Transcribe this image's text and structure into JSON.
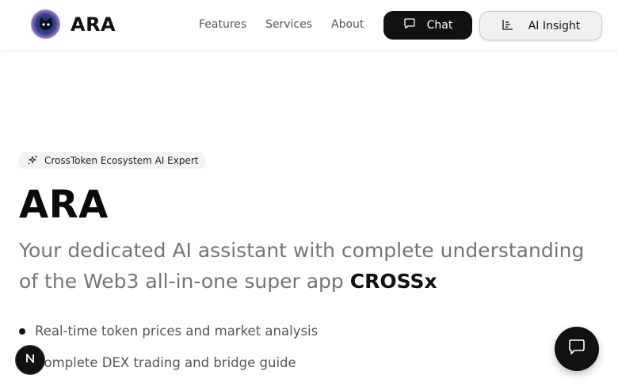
{
  "header": {
    "brand": "ARA",
    "nav": [
      "Features",
      "Services",
      "About"
    ],
    "chat_label": "Chat",
    "insight_label": "AI Insight"
  },
  "hero": {
    "badge": "CrossToken Ecosystem AI Expert",
    "title": "ARA",
    "subtitle": "Your dedicated AI assistant with complete understanding of the Web3 all-in-one super app",
    "subtitle_strong": "CROSSx",
    "features": [
      "Real-time token prices and market analysis",
      "Complete DEX trading and bridge guide"
    ]
  },
  "icons": {
    "logo": "ara-cat-logo-icon",
    "chat": "chat-bubble-icon",
    "insight": "bar-chart-icon",
    "badge": "sparkle-icon",
    "nextjs": "nextjs-n-icon",
    "fab": "chat-bubble-icon"
  },
  "colors": {
    "primary": "#111111",
    "muted_text": "#757575",
    "badge_bg": "#f3f4f2"
  }
}
